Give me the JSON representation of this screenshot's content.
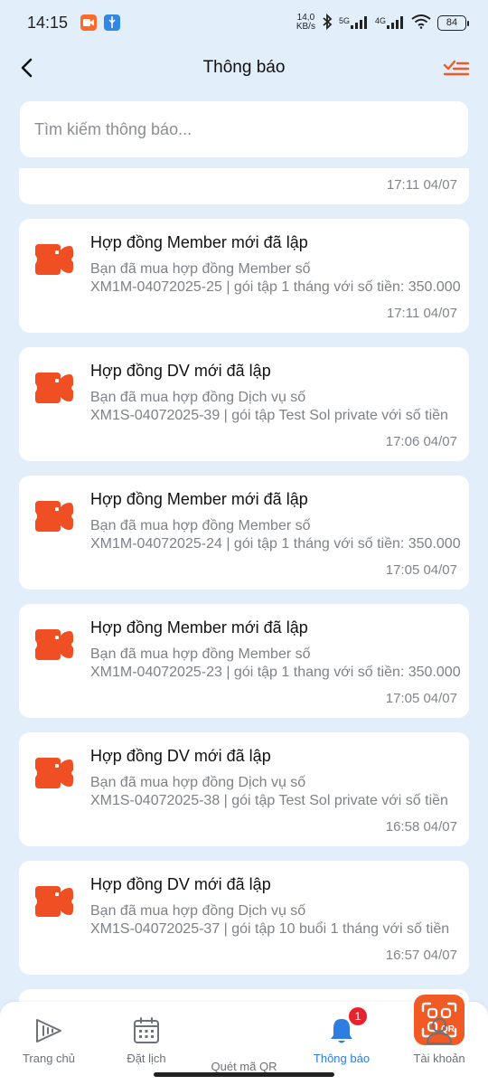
{
  "status_bar": {
    "time": "14:15",
    "speed_value": "14,0",
    "speed_unit": "KB/s",
    "net1": "5G",
    "net2": "4G",
    "battery": "84"
  },
  "header": {
    "title": "Thông báo",
    "back_icon": "chevron-left-icon",
    "mark_all_icon": "mark-all-read-icon",
    "accent_color": "#f15a24"
  },
  "search": {
    "placeholder": "Tìm kiếm thông báo..."
  },
  "notifications": [
    {
      "title": "",
      "line1": "",
      "line2": "",
      "time": "17:11 04/07"
    },
    {
      "title": "Hợp đồng Member mới đã lập",
      "line1": "Bạn đã mua hợp đồng Member số",
      "line2": "XM1M-04072025-25 | gói tập 1 tháng với số tiền: 350.000",
      "time": "17:11 04/07"
    },
    {
      "title": "Hợp đồng DV mới đã lập",
      "line1": "Bạn đã mua hợp đồng Dịch vụ số",
      "line2": "XM1S-04072025-39 | gói tập Test Sol private với số tiền",
      "time": "17:06 04/07"
    },
    {
      "title": "Hợp đồng Member mới đã lập",
      "line1": "Bạn đã mua hợp đồng Member số",
      "line2": "XM1M-04072025-24 | gói tập 1 tháng với số tiền: 350.000",
      "time": "17:05 04/07"
    },
    {
      "title": "Hợp đồng Member mới đã lập",
      "line1": "Bạn đã mua hợp đồng Member số",
      "line2": "XM1M-04072025-23 | gói tập 1 thang với số tiền: 350.000",
      "time": "17:05 04/07"
    },
    {
      "title": "Hợp đồng DV mới đã lập",
      "line1": "Bạn đã mua hợp đồng Dịch vụ số",
      "line2": "XM1S-04072025-38 | gói tập Test Sol private với số tiền",
      "time": "16:58 04/07"
    },
    {
      "title": "Hợp đồng DV mới đã lập",
      "line1": "Bạn đã mua hợp đồng Dịch vụ số",
      "line2": "XM1S-04072025-37 | gói tập 10 buổi 1 tháng với số tiền",
      "time": "16:57 04/07"
    }
  ],
  "bottom_nav": {
    "items": [
      {
        "label": "Trang chủ",
        "icon": "home-play-icon"
      },
      {
        "label": "Đặt lịch",
        "icon": "calendar-icon"
      },
      {
        "label": "Quét mã QR",
        "icon": "qr-scan-icon"
      },
      {
        "label": "Thông báo",
        "icon": "bell-icon",
        "badge": "1"
      },
      {
        "label": "Tài khoản",
        "icon": "user-icon"
      }
    ],
    "active_color": "#2f7de1"
  }
}
